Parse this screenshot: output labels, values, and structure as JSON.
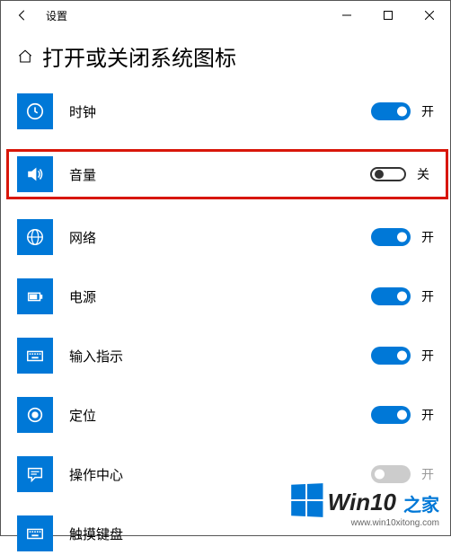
{
  "titlebar": {
    "title": "设置"
  },
  "heading": "打开或关闭系统图标",
  "state_on": "开",
  "state_off": "关",
  "items": [
    {
      "label": "时钟",
      "on": true
    },
    {
      "label": "音量",
      "on": false,
      "highlight": true
    },
    {
      "label": "网络",
      "on": true
    },
    {
      "label": "电源",
      "on": true
    },
    {
      "label": "输入指示",
      "on": true
    },
    {
      "label": "定位",
      "on": true
    },
    {
      "label": "操作中心",
      "on": true,
      "disabled": true
    },
    {
      "label": "触摸键盘",
      "on": true
    }
  ],
  "watermark": {
    "text": "Win10",
    "suffix": "之家",
    "url": "www.win10xitong.com"
  }
}
